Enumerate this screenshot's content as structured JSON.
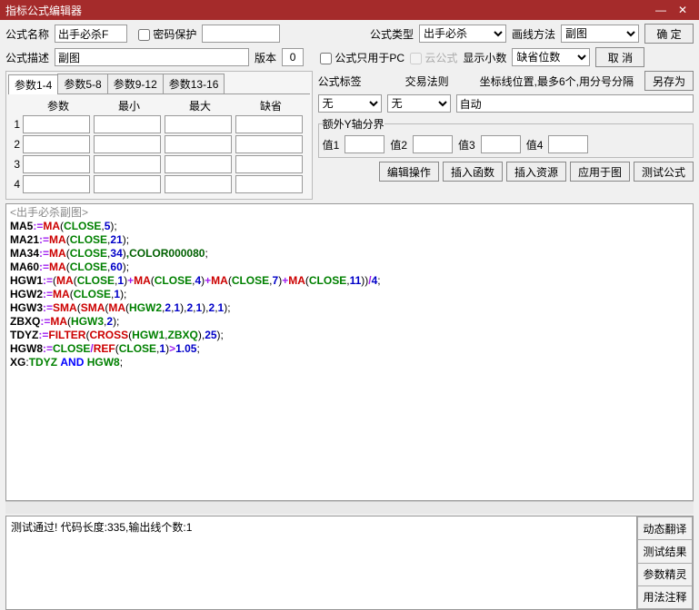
{
  "window": {
    "title": "指标公式编辑器"
  },
  "labels": {
    "name": "公式名称",
    "pwd": "密码保护",
    "desc": "公式描述",
    "version": "版本",
    "type": "公式类型",
    "drawMethod": "画线方法",
    "pcOnly": "公式只用于PC",
    "cloud": "云公式",
    "decimals": "显示小数",
    "tag": "公式标签",
    "tradeRule": "交易法则",
    "coordHint": "坐标线位置,最多6个,用分号分隔",
    "yaxis": "额外Y轴分界",
    "v1": "值1",
    "v2": "值2",
    "v3": "值3",
    "v4": "值4"
  },
  "fields": {
    "name": "出手必杀F",
    "desc": "副图",
    "version": "0",
    "type": "出手必杀",
    "drawMethod": "副图",
    "decimals": "缺省位数",
    "tag": "无",
    "tradeRule": "无",
    "coord": "自动"
  },
  "buttons": {
    "ok": "确 定",
    "cancel": "取 消",
    "saveAs": "另存为",
    "editOp": "编辑操作",
    "insFn": "插入函数",
    "insRes": "插入资源",
    "applyFig": "应用于图",
    "testFml": "测试公式",
    "dynTrans": "动态翻译",
    "testResult": "测试结果",
    "paramWizard": "参数精灵",
    "usage": "用法注释"
  },
  "tabs": {
    "t1": "参数1-4",
    "t2": "参数5-8",
    "t3": "参数9-12",
    "t4": "参数13-16"
  },
  "paramHead": {
    "p": "参数",
    "min": "最小",
    "max": "最大",
    "def": "缺省"
  },
  "codeTitle": "出手必杀副图",
  "code": [
    {
      "v": "MA5",
      "f": "MA",
      "a": [
        "CLOSE",
        "5"
      ]
    },
    {
      "v": "MA21",
      "f": "MA",
      "a": [
        "CLOSE",
        "21"
      ]
    },
    {
      "v": "MA34",
      "f": "MA",
      "a": [
        "CLOSE",
        "34"
      ],
      "suffix": ",COLOR000080"
    },
    {
      "v": "MA60",
      "f": "MA",
      "a": [
        "CLOSE",
        "60"
      ]
    }
  ],
  "hgw1": {
    "v": "HGW1",
    "parts": [
      [
        "CLOSE",
        "1"
      ],
      [
        "CLOSE",
        "4"
      ],
      [
        "CLOSE",
        "7"
      ],
      [
        "CLOSE",
        "11"
      ]
    ],
    "div": "4"
  },
  "hgw2": {
    "v": "HGW2",
    "f": "MA",
    "a": [
      "CLOSE",
      "1"
    ]
  },
  "hgw3": {
    "v": "HGW3",
    "inner": "HGW2",
    "nums": [
      "2",
      "1",
      "2",
      "1",
      "2",
      "1"
    ]
  },
  "zbxq": {
    "v": "ZBXQ",
    "f": "MA",
    "a": [
      "HGW3",
      "2"
    ]
  },
  "tdyz": {
    "v": "TDYZ",
    "a": [
      "HGW1",
      "ZBXQ"
    ],
    "n": "25"
  },
  "hgw8": {
    "v": "HGW8",
    "a": "CLOSE",
    "b": "CLOSE",
    "n": "1",
    "cmp": "1.05"
  },
  "xg": {
    "v": "XG",
    "a": "TDYZ",
    "kw": "AND",
    "b": "HGW8"
  },
  "status": "测试通过! 代码长度:335,输出线个数:1"
}
